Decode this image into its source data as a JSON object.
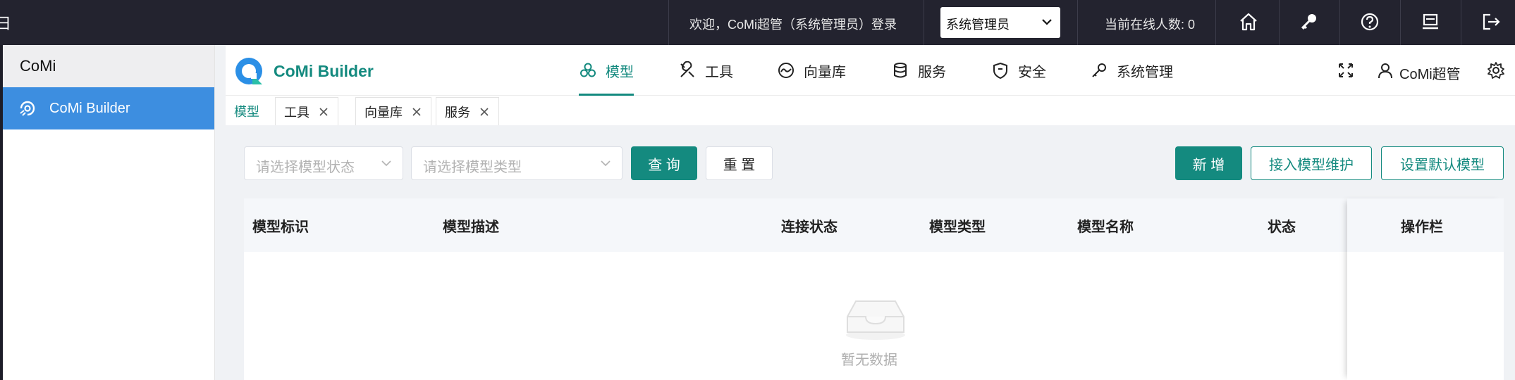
{
  "topbar": {
    "clipped_char": "日",
    "welcome": "欢迎，CoMi超管（系统管理员）登录",
    "role_select": "系统管理员",
    "online_users": "当前在线人数: 0",
    "icons": [
      "home-icon",
      "key-icon",
      "help-icon",
      "monitor-icon",
      "logout-icon"
    ]
  },
  "sidebar": {
    "title": "CoMi",
    "items": [
      {
        "label": "CoMi Builder",
        "icon": "builder-icon",
        "active": true
      }
    ]
  },
  "header": {
    "brand": "CoMi Builder",
    "nav": [
      {
        "label": "模型",
        "icon": "model-icon",
        "active": true
      },
      {
        "label": "工具",
        "icon": "tools-icon"
      },
      {
        "label": "向量库",
        "icon": "vector-icon"
      },
      {
        "label": "服务",
        "icon": "database-icon"
      },
      {
        "label": "安全",
        "icon": "shield-icon"
      },
      {
        "label": "系统管理",
        "icon": "wrench-icon"
      }
    ],
    "user": "CoMi超管"
  },
  "tabs": [
    {
      "label": "模型",
      "active": true
    },
    {
      "label": "工具"
    },
    {
      "label": "向量库"
    },
    {
      "label": "服务"
    }
  ],
  "filters": {
    "status_placeholder": "请选择模型状态",
    "type_placeholder": "请选择模型类型",
    "query": "查 询",
    "reset": "重 置"
  },
  "actions": {
    "add": "新 增",
    "maintain": "接入模型维护",
    "set_default": "设置默认模型"
  },
  "table": {
    "columns": [
      "模型标识",
      "模型描述",
      "连接状态",
      "模型类型",
      "模型名称",
      "状态",
      "操作栏"
    ],
    "empty_text": "暂无数据"
  },
  "colors": {
    "topbar": "#23232f",
    "accent": "#148a7f",
    "sidebar_active": "#3d8ee0"
  }
}
